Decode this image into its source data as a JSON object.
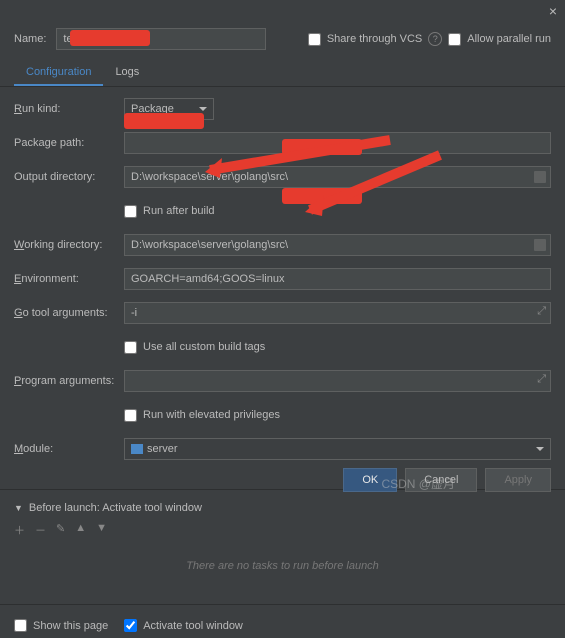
{
  "titlebar": {
    "close": "×"
  },
  "name": {
    "label": "Name:",
    "value": "te_linux"
  },
  "share_vcs": {
    "label": "Share through VCS",
    "checked": false
  },
  "allow_parallel": {
    "label": "Allow parallel run",
    "checked": false
  },
  "tabs": {
    "configuration": "Configuration",
    "logs": "Logs"
  },
  "form": {
    "run_kind": {
      "label": "Run kind:",
      "value": "Package"
    },
    "package_path": {
      "label": "Package path:",
      "value": ""
    },
    "output_dir": {
      "label": "Output directory:",
      "value": "D:\\workspace\\server\\golang\\src\\"
    },
    "run_after_build": {
      "label": "Run after build",
      "checked": false
    },
    "working_dir": {
      "label": "Working directory:",
      "value": "D:\\workspace\\server\\golang\\src\\"
    },
    "environment": {
      "label": "Environment:",
      "value": "GOARCH=amd64;GOOS=linux"
    },
    "go_tool_args": {
      "label": "Go tool arguments:",
      "value": "-i"
    },
    "custom_tags": {
      "label": "Use all custom build tags",
      "checked": false
    },
    "program_args": {
      "label": "Program arguments:",
      "value": ""
    },
    "elevated": {
      "label": "Run with elevated privileges",
      "checked": false
    },
    "module": {
      "label": "Module:",
      "value": "server"
    }
  },
  "before_launch": {
    "header": "Before launch: Activate tool window",
    "empty": "There are no tasks to run before launch"
  },
  "bottom": {
    "show_page": {
      "label": "Show this page",
      "checked": false
    },
    "activate_tool": {
      "label": "Activate tool window",
      "checked": true
    }
  },
  "buttons": {
    "ok": "OK",
    "cancel": "Cancel",
    "apply": "Apply"
  },
  "watermark": "CSDN @虚月"
}
